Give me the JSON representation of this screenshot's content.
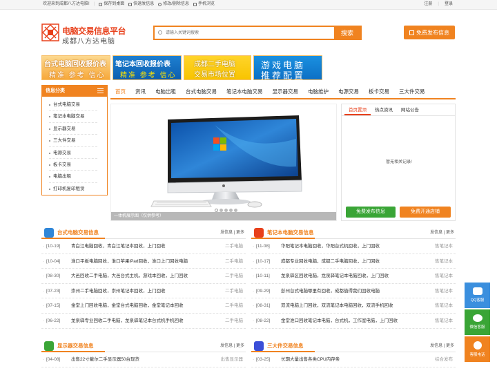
{
  "topbar": {
    "welcome": "欢迎来到成都八方达电脑!",
    "links": [
      "保存到桌面",
      "快速发信息",
      "修改/删除信息",
      "手机浏览"
    ],
    "register": "注册",
    "login": "登录"
  },
  "logo": {
    "title": "电脑交易信息平台",
    "subtitle": "成都八方达电脑"
  },
  "search": {
    "placeholder": "请输入关键词搜索",
    "button": "搜索"
  },
  "publish_button": "免费发布信息",
  "banners": [
    {
      "line1": "台式电脑回收报价表",
      "line2": "精准 参考 信心"
    },
    {
      "line1": "笔记本回收报价表",
      "line2": "精准 参考 信心"
    },
    {
      "line1": "成都二手电脑",
      "line2": "交易市场位置"
    },
    {
      "line1": "游戏电脑",
      "line2": "推荐配置"
    }
  ],
  "category": {
    "title": "信息分类",
    "items": [
      "台式电脑交易",
      "笔记本电脑交易",
      "显示器交易",
      "三大件交易",
      "电源交易",
      "板卡交易",
      "电脑出租",
      "打印机复印租赁"
    ]
  },
  "nav": [
    "首页",
    "资讯",
    "电脑出租",
    "台式电脑交易",
    "笔记本电脑交易",
    "显示器交易",
    "电脑维护",
    "电源交易",
    "板卡交易",
    "三大件交易"
  ],
  "slider": {
    "caption": "一体机展示图（仅供参考）"
  },
  "news": {
    "tabs": [
      "首页置顶",
      "热点资讯",
      "网站公告"
    ],
    "empty": "暂无相关记录!",
    "btn_publish": "免费发布信息",
    "btn_shop": "免费开通店铺"
  },
  "panels": {
    "desktop": {
      "title": "台式电脑交易信息",
      "more": "发信息 | 更多",
      "rows": [
        {
          "date": "[10-19]",
          "text": "青白江电脑回收，青白江笔记本回收，上门回收",
          "tag": "二手电脑"
        },
        {
          "date": "[10-04]",
          "text": "淮口平板电脑回收，淮口苹果iPad回收，淮口上门回收电脑",
          "tag": "二手电脑"
        },
        {
          "date": "[08-30]",
          "text": "大邑回收二手电脑，大邑台式主机，游戏本回收，上门回收",
          "tag": "二手电脑"
        },
        {
          "date": "[07-23]",
          "text": "崇州二手电脑回收，崇州笔记本回收，上门回收",
          "tag": "二手电脑"
        },
        {
          "date": "[07-15]",
          "text": "金堂上门回收电脑，金堂台式电脑回收，金堂笔记本回收",
          "tag": "二手电脑"
        },
        {
          "date": "[06-22]",
          "text": "龙泉驿专业回收二手电脑，龙泉驿笔记本台式机手机回收",
          "tag": "二手电脑"
        }
      ]
    },
    "laptop": {
      "title": "笔记本电脑交易信息",
      "more": "发信息 | 更多",
      "rows": [
        {
          "date": "[11-08]",
          "text": "华阳笔记本电脑回收，华阳台式机回收，上门回收",
          "tag": "售笔记本"
        },
        {
          "date": "[10-17]",
          "text": "成都专业回收电脑，成都二手电脑回收，上门回收",
          "tag": "售笔记本"
        },
        {
          "date": "[10-11]",
          "text": "龙泉驿区回收电脑，龙泉驿笔记本电脑回收，上门回收",
          "tag": "售笔记本"
        },
        {
          "date": "[09-29]",
          "text": "彭州台式电脑哪里有回收，成都值得我们回收电脑",
          "tag": "售笔记本"
        },
        {
          "date": "[08-31]",
          "text": "双流电脑上门回收，双流笔记本电脑回收，双流手机回收",
          "tag": "售笔记本"
        },
        {
          "date": "[08-22]",
          "text": "金堂淮口回收笔记本电脑，台式机，工作室电脑，上门回收",
          "tag": "售笔记本"
        }
      ]
    },
    "monitor": {
      "title": "显示器交易信息",
      "more": "发信息 | 更多",
      "rows": [
        {
          "date": "[04-08]",
          "text": "出售22寸戴尔二手显示器50台现货",
          "tag": "出售显示器"
        }
      ]
    },
    "parts": {
      "title": "三大件交易信息",
      "more": "发信息 | 更多",
      "rows": [
        {
          "date": "[03-25]",
          "text": "长期大量出售各类CPU内存条",
          "tag": "综合发布"
        }
      ]
    }
  },
  "float": [
    {
      "label": "QQ客服",
      "color": "#3b8fde"
    },
    {
      "label": "微信客服",
      "color": "#3aa536"
    },
    {
      "label": "客服电话",
      "color": "#f08320"
    }
  ]
}
